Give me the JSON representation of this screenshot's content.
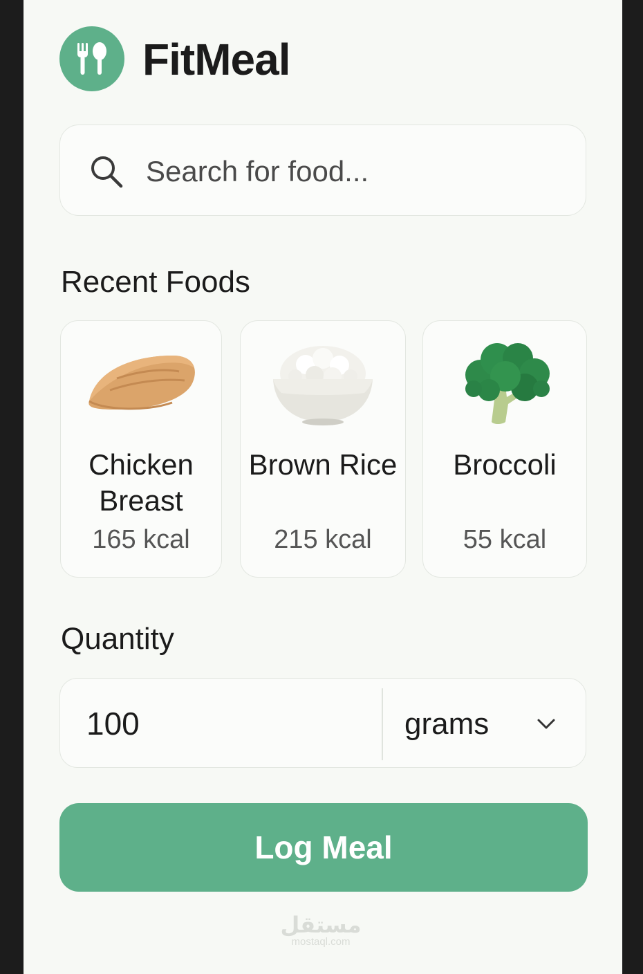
{
  "app": {
    "title": "FitMeal",
    "logo_icon": "fork-spoon-icon",
    "accent": "#5eb08a"
  },
  "search": {
    "placeholder": "Search for food...",
    "icon": "search-icon"
  },
  "recent": {
    "heading": "Recent Foods",
    "items": [
      {
        "name": "Chicken Breast",
        "kcal": "165 kcal",
        "icon": "chicken-breast-image"
      },
      {
        "name": "Brown Rice",
        "kcal": "215 kcal",
        "icon": "rice-bowl-image"
      },
      {
        "name": "Broccoli",
        "kcal": "55 kcal",
        "icon": "broccoli-image"
      }
    ]
  },
  "quantity": {
    "heading": "Quantity",
    "value": "100",
    "unit": "grams",
    "chevron": "chevron-down-icon"
  },
  "action": {
    "log_label": "Log Meal"
  },
  "watermark": {
    "arabic": "مستقل",
    "url": "mostaql.com"
  }
}
